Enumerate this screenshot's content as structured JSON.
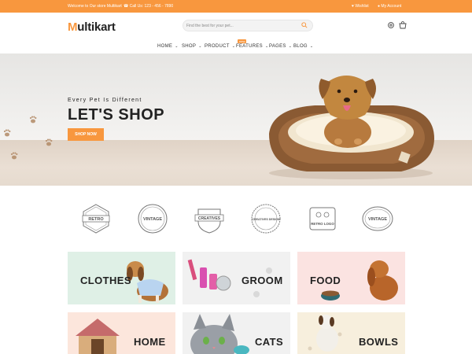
{
  "topbar": {
    "welcome": "Welcome to Our store Multikart",
    "call": "Call Us: 123 - 456 - 7890",
    "wishlist": "Wishlist",
    "account": "My Account"
  },
  "header": {
    "logo_initial": "M",
    "logo_rest": "ultikart",
    "search_placeholder": "Find the best for your pet..."
  },
  "nav": {
    "items": [
      {
        "label": "HOME"
      },
      {
        "label": "SHOP"
      },
      {
        "label": "PRODUCT"
      },
      {
        "label": "FEATURES"
      },
      {
        "label": "PAGES"
      },
      {
        "label": "BLOG"
      }
    ],
    "new_badge": "new"
  },
  "hero": {
    "tagline": "Every Pet Is Different",
    "title": "LET'S SHOP",
    "button": "SHOP NOW"
  },
  "brands": [
    "RETRO",
    "VINTAGE",
    "CREATIVES",
    "CREATIVES DESIGN",
    "RETRO LOGO",
    "VINTAGE"
  ],
  "categories": [
    {
      "label": "CLOTHES"
    },
    {
      "label": "GROOM"
    },
    {
      "label": "FOOD"
    },
    {
      "label": "HOME"
    },
    {
      "label": "CATS"
    },
    {
      "label": "BOWLS"
    }
  ],
  "colors": {
    "accent": "#f8973e",
    "tile_mint": "#dff0e6",
    "tile_grey": "#f1f1f1",
    "tile_pink": "#fbe3e1",
    "tile_peach": "#fce6dc",
    "tile_cream": "#f7efdd"
  }
}
